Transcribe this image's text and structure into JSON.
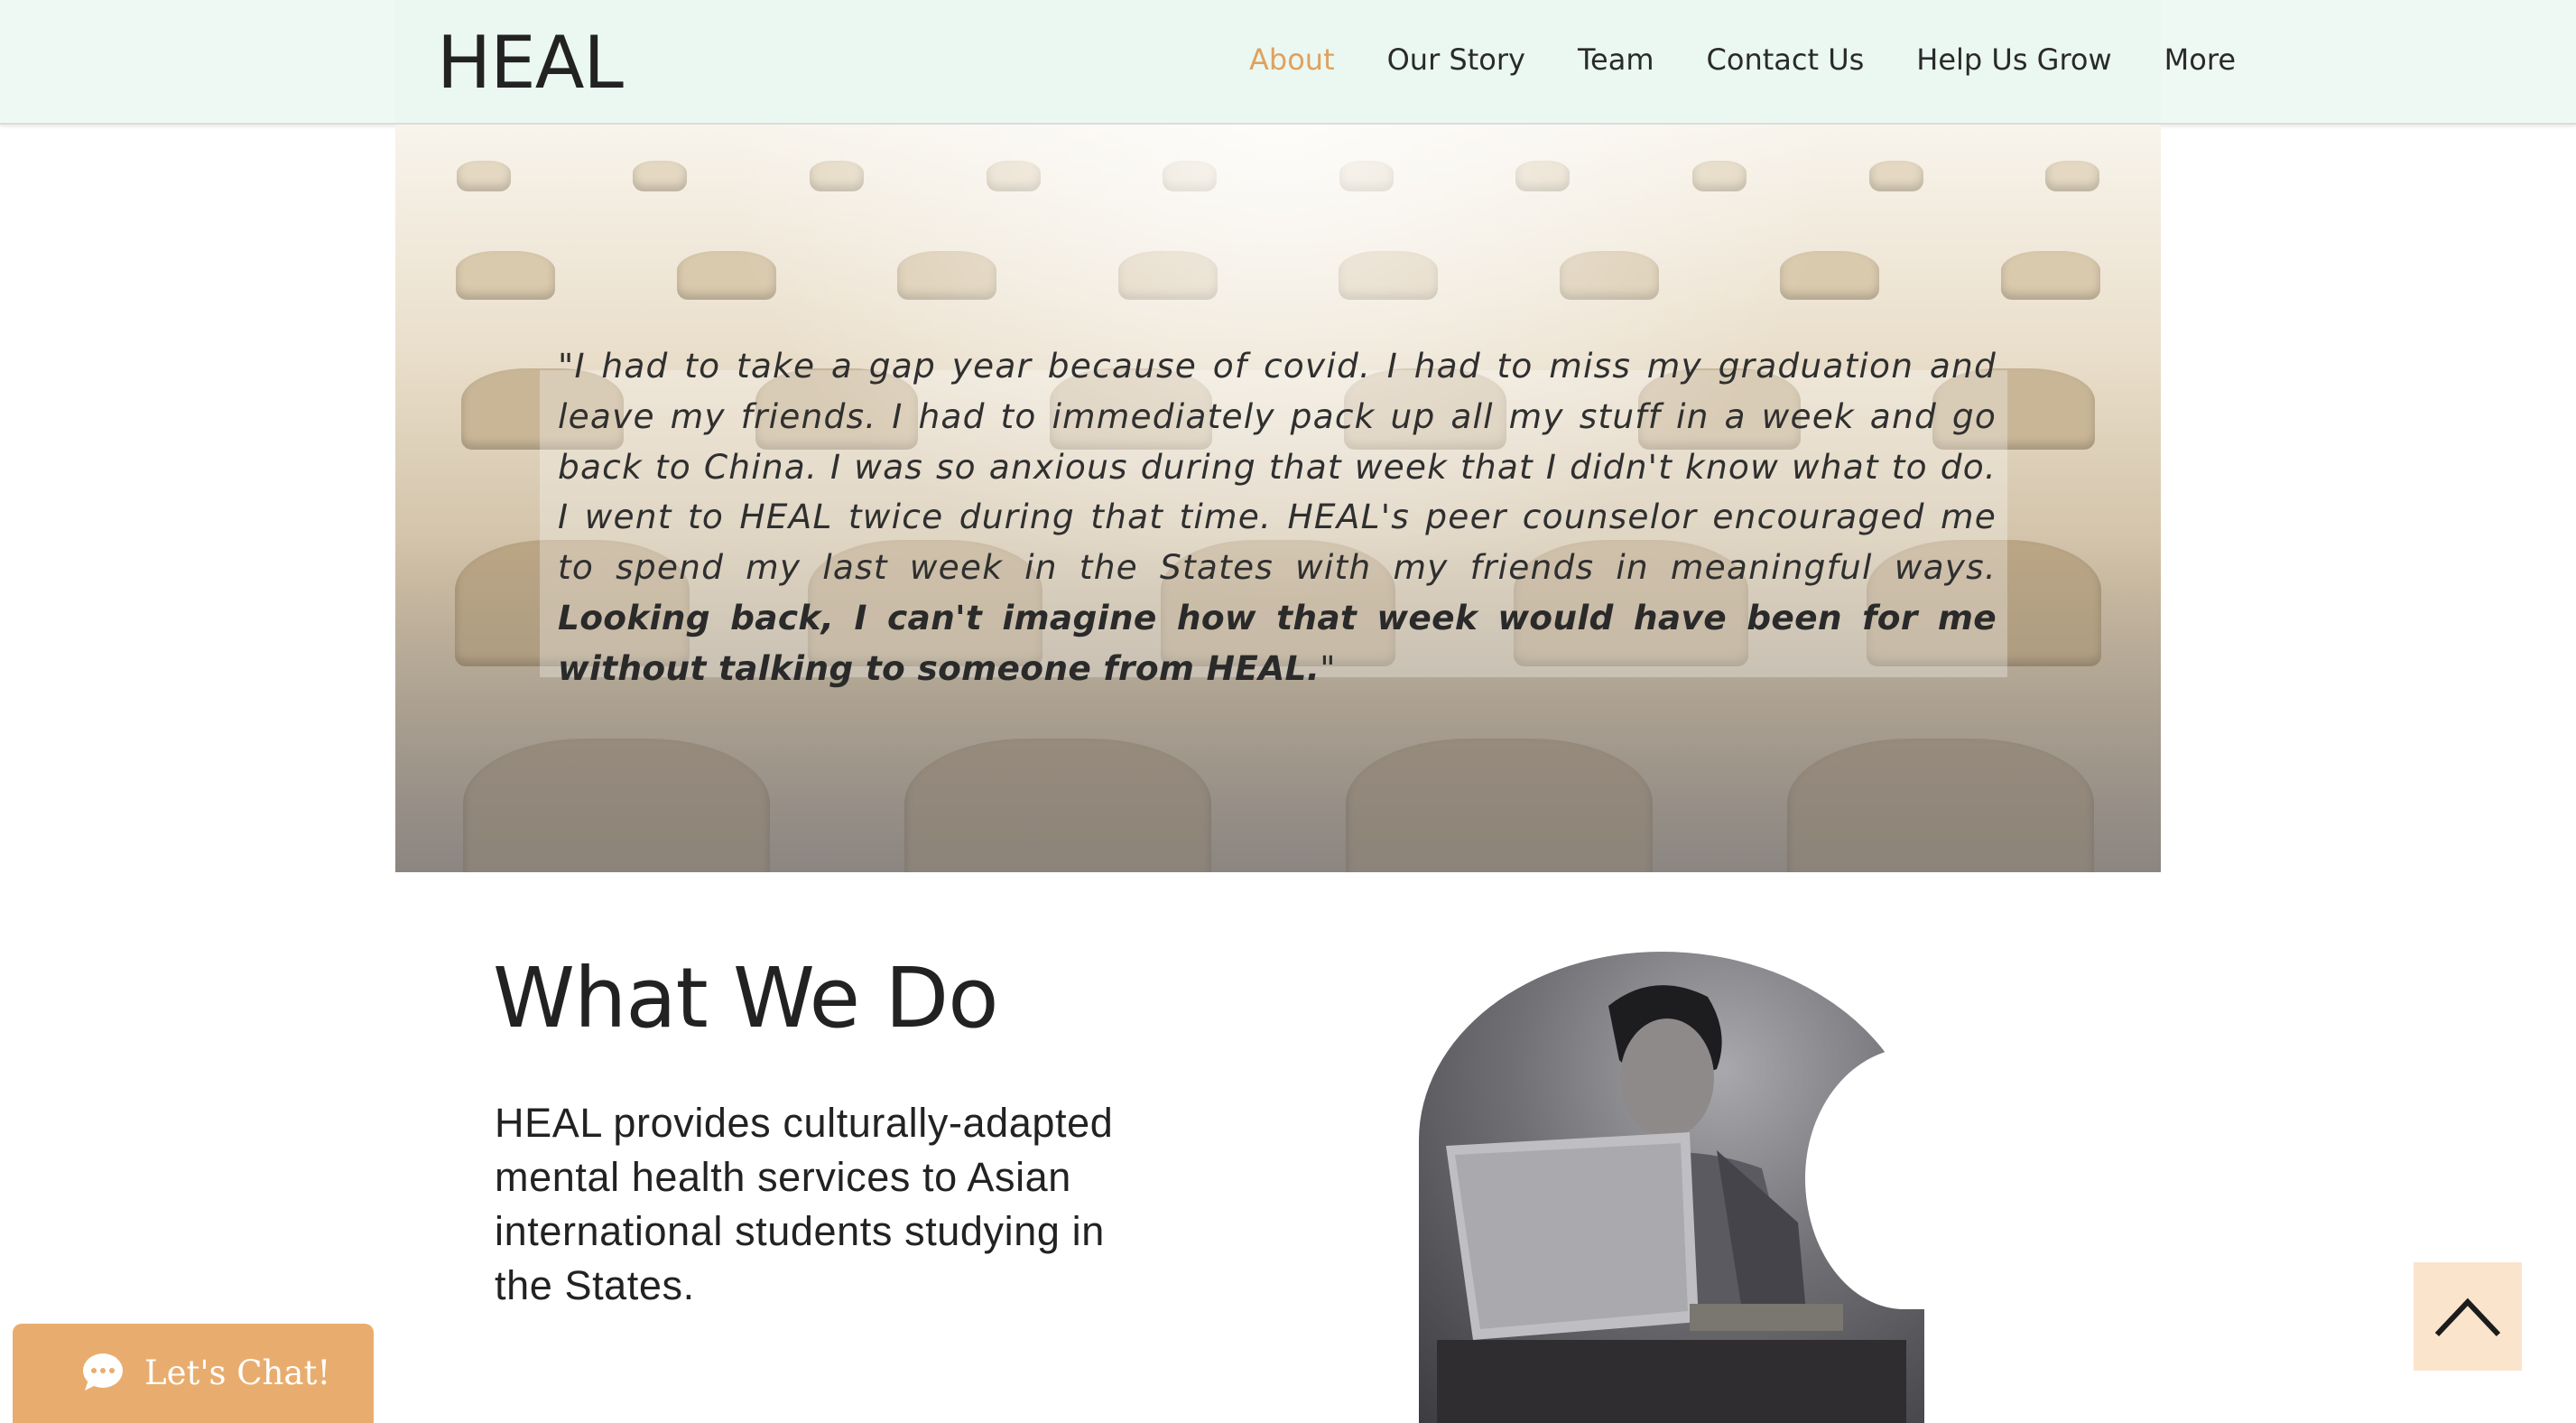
{
  "header": {
    "logo": "HEAL",
    "nav": [
      {
        "label": "About",
        "active": true
      },
      {
        "label": "Our Story",
        "active": false
      },
      {
        "label": "Team",
        "active": false
      },
      {
        "label": "Contact Us",
        "active": false
      },
      {
        "label": "Help Us Grow",
        "active": false
      },
      {
        "label": "More",
        "active": false
      }
    ]
  },
  "hero": {
    "quote_plain": "\"I had to take a gap year because of covid. I had to miss my graduation and leave my friends. I had to immediately pack up all my stuff in a week and go back to China. I was so anxious during that week that I didn't know what to do. I went to HEAL twice during that time. HEAL's peer counselor encouraged me to spend my last week in the States with my friends in meaningful ways. ",
    "quote_bold": "Looking back, I can't imagine how that week would have been for me without talking to someone from HEAL.",
    "quote_close": "\""
  },
  "what_we_do": {
    "title": "What We Do",
    "text": "HEAL provides culturally-adapted mental health services to Asian international students studying in the States."
  },
  "chat": {
    "label": "Let's Chat!"
  },
  "colors": {
    "header_bg": "#eaf8f1",
    "nav_active": "#e0a15e",
    "chat_bg": "#e8ad6e",
    "back_to_top_bg": "#fbe4cc"
  },
  "icons": {
    "chat": "chat-bubble-icon",
    "back_to_top": "chevron-up-icon"
  }
}
